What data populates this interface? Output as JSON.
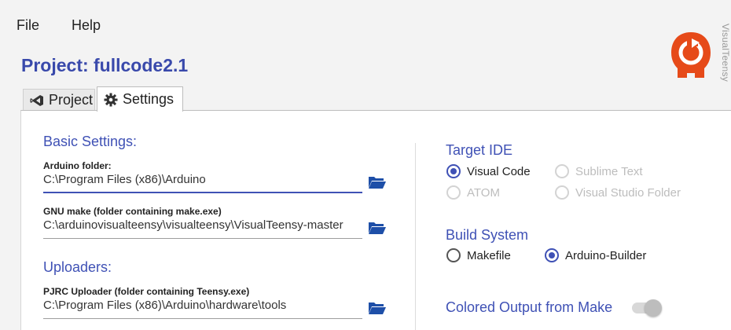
{
  "menu": {
    "file": "File",
    "help": "Help"
  },
  "header": {
    "project_title": "Project: fullcode2.1",
    "app_name": "VisualTeensy"
  },
  "tabs": [
    {
      "label": "Project",
      "icon": "vscode-icon",
      "active": false
    },
    {
      "label": "Settings",
      "icon": "gear-icon",
      "active": true
    }
  ],
  "basic": {
    "title": "Basic Settings:",
    "arduino_label": "Arduino folder:",
    "arduino_value": "C:\\Program Files (x86)\\Arduino",
    "make_label": "GNU make (folder containing make.exe)",
    "make_value": "C:\\arduinovisualteensy\\visualteensy\\VisualTeensy-master"
  },
  "uploaders": {
    "title": "Uploaders:",
    "pjrc_label": "PJRC Uploader (folder containing Teensy.exe)",
    "pjrc_value": "C:\\Program Files (x86)\\Arduino\\hardware\\tools"
  },
  "target_ide": {
    "title": "Target IDE",
    "options": [
      {
        "label": "Visual Code",
        "selected": true,
        "enabled": true
      },
      {
        "label": "Sublime Text",
        "selected": false,
        "enabled": false
      },
      {
        "label": "ATOM",
        "selected": false,
        "enabled": false
      },
      {
        "label": "Visual Studio Folder",
        "selected": false,
        "enabled": false
      }
    ]
  },
  "build_system": {
    "title": "Build System",
    "options": [
      {
        "label": "Makefile",
        "selected": false
      },
      {
        "label": "Arduino-Builder",
        "selected": true
      }
    ]
  },
  "colored_output": {
    "title": "Colored Output from Make",
    "enabled": false
  },
  "colors": {
    "accent": "#3f51b5",
    "title": "#3949ab",
    "logo": "#e64a19"
  }
}
